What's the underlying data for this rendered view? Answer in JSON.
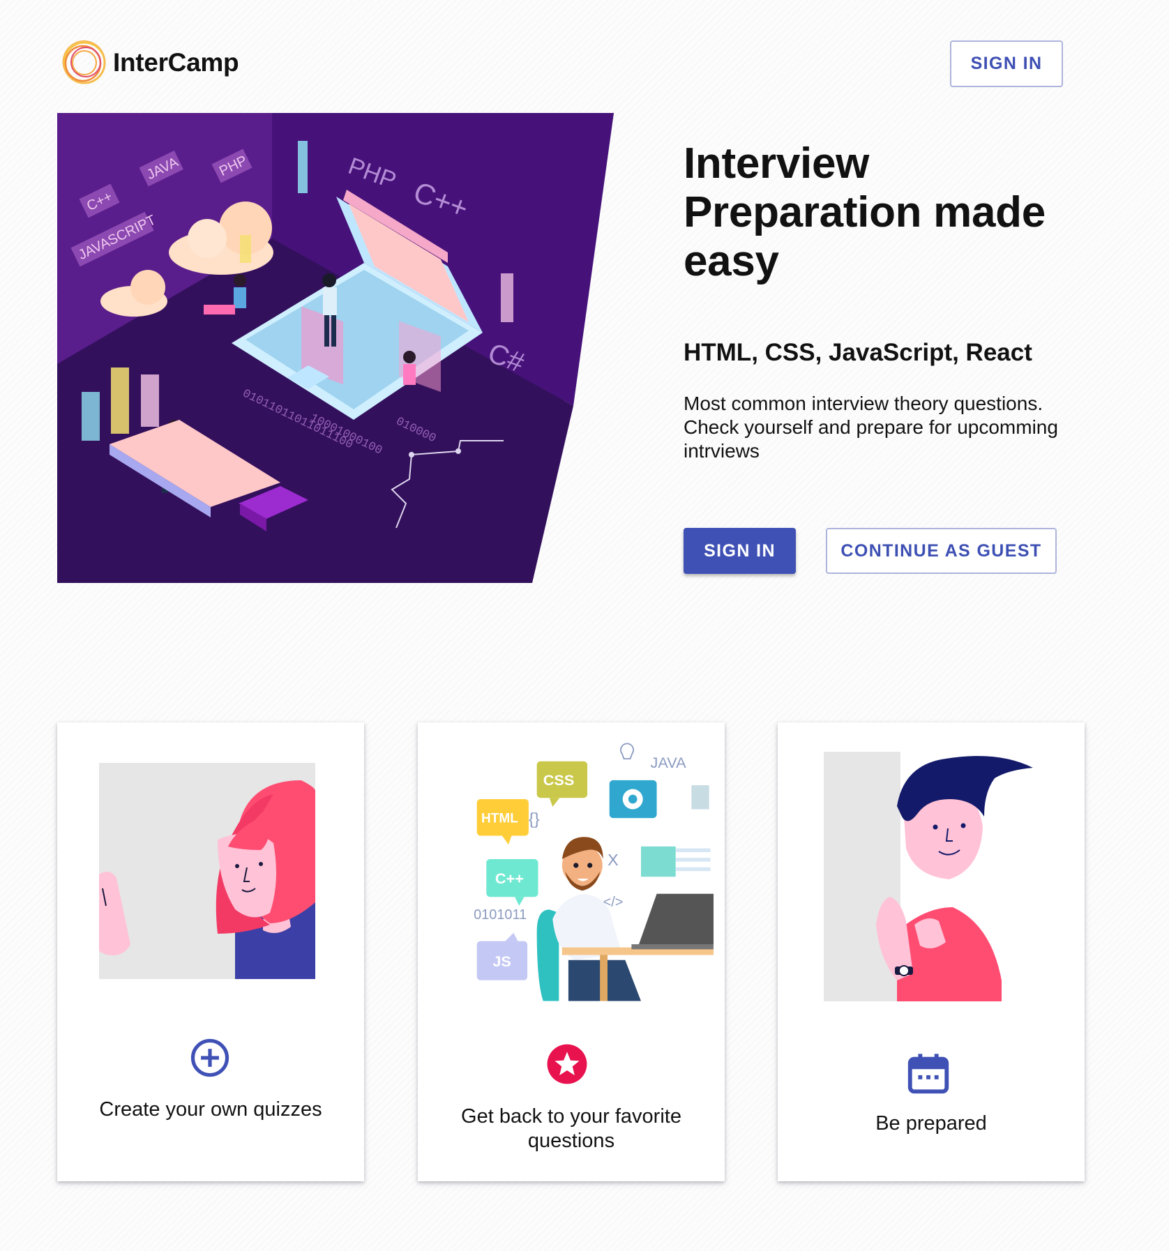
{
  "brand": {
    "name": "InterCamp",
    "logo_colors": [
      "#f7c340",
      "#f08a3a",
      "#e04a6a"
    ]
  },
  "header": {
    "sign_in_label": "SIGN IN"
  },
  "hero": {
    "illustration_labels": [
      "C++",
      "JAVA",
      "PHP",
      "JAVASCRIPT",
      "PHP",
      "C++",
      "C#",
      "01011011011011100",
      "10001000100",
      "010000"
    ],
    "title": "Interview Preparation made easy",
    "subtitle": "HTML, CSS, JavaScript, React",
    "description": "Most common interview theory questions. Check yourself and prepare for upcomming intrviews",
    "sign_in_label": "SIGN IN",
    "guest_label": "CONTINUE AS GUEST"
  },
  "features": [
    {
      "label": "Create your own quizzes",
      "icon": "add-circle-icon"
    },
    {
      "label": "Get back to your favorite questions",
      "icon": "star-icon",
      "art_labels": [
        "CSS",
        "HTML",
        "C++",
        "JS",
        "JAVA",
        "0101011",
        "{}",
        "</>",
        "X"
      ]
    },
    {
      "label": "Be prepared",
      "icon": "calendar-icon"
    }
  ],
  "colors": {
    "primary": "#3f51b5",
    "accent": "#e8124e",
    "hero_bg": "#4a1578"
  }
}
